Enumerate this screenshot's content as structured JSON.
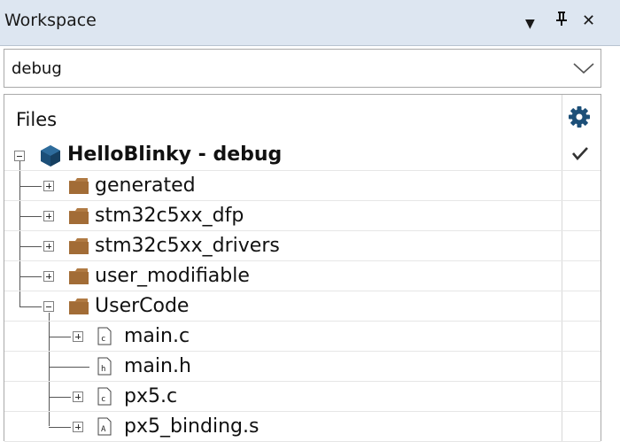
{
  "panel": {
    "title": "Workspace",
    "controls": [
      {
        "icon": "dropdown-arrow-icon",
        "glyph": "▼"
      },
      {
        "icon": "pin-icon",
        "glyph": "⊥"
      },
      {
        "icon": "close-icon",
        "glyph": "✕"
      }
    ]
  },
  "config": {
    "selected": "debug"
  },
  "files": {
    "header": "Files",
    "root": {
      "label": "HelloBlinky - debug",
      "icon": "project-cube-icon",
      "status": "checkmark-icon"
    },
    "folders": [
      {
        "label": "generated",
        "expanded": false
      },
      {
        "label": "stm32c5xx_dfp",
        "expanded": false
      },
      {
        "label": "stm32c5xx_drivers",
        "expanded": false
      },
      {
        "label": "user_modifiable",
        "expanded": false
      },
      {
        "label": "UserCode",
        "expanded": true
      }
    ],
    "usercode_files": [
      {
        "label": "main.c",
        "icon_letter": "c",
        "expandable": true
      },
      {
        "label": "main.h",
        "icon_letter": "h",
        "expandable": false
      },
      {
        "label": "px5.c",
        "icon_letter": "c",
        "expandable": true
      },
      {
        "label": "px5_binding.s",
        "icon_letter": "A",
        "expandable": true
      }
    ]
  },
  "colors": {
    "titlebar": "#dde6f1",
    "folder": "#b07a43",
    "project_cube": "#1c4f78"
  }
}
